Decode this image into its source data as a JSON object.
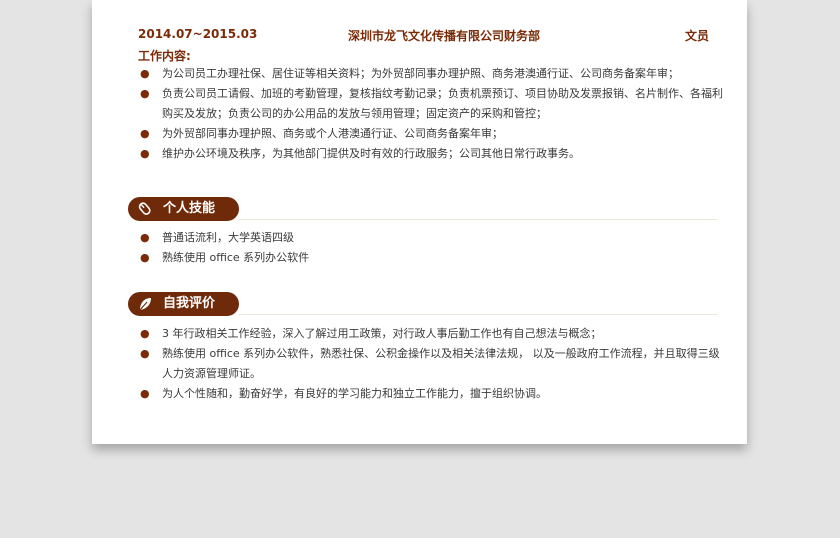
{
  "experience": {
    "date": "2014.07~2015.03",
    "company": "深圳市龙飞文化传播有限公司财务部",
    "role": "文员",
    "content_label": "工作内容:",
    "items": [
      "为公司员工办理社保、居住证等相关资料；为外贸部同事办理护照、商务港澳通行证、公司商务备案年审；",
      "负责公司员工请假、加班的考勤管理，复核指纹考勤记录；负责机票预订、项目协助及发票报销、名片制作、各福利购买及发放；负责公司的办公用品的发放与领用管理；固定资产的采购和管控；",
      "为外贸部同事办理护照、商务或个人港澳通行证、公司商务备案年审；",
      "维护办公环境及秩序，为其他部门提供及时有效的行政服务；公司其他日常行政事务。"
    ]
  },
  "skills": {
    "title": "个人技能",
    "icon": "mouse-icon",
    "items": [
      "普通话流利，大学英语四级",
      "熟练使用 office 系列办公软件"
    ]
  },
  "evaluation": {
    "title": "自我评价",
    "icon": "leaf-icon",
    "items": [
      "3 年行政相关工作经验，深入了解过用工政策，对行政人事后勤工作也有自己想法与概念；",
      "熟练使用 office 系列办公软件，熟悉社保、公积金操作以及相关法律法规， 以及一般政府工作流程，并且取得三级人力资源管理师证。",
      "为人个性随和，勤奋好学，有良好的学习能力和独立工作能力，擅于组织协调。"
    ]
  },
  "colors": {
    "accent": "#6f2a0a",
    "heading_text": "#7a2c08",
    "body_text": "#3a3a3a",
    "background": "#e4e4e4"
  }
}
